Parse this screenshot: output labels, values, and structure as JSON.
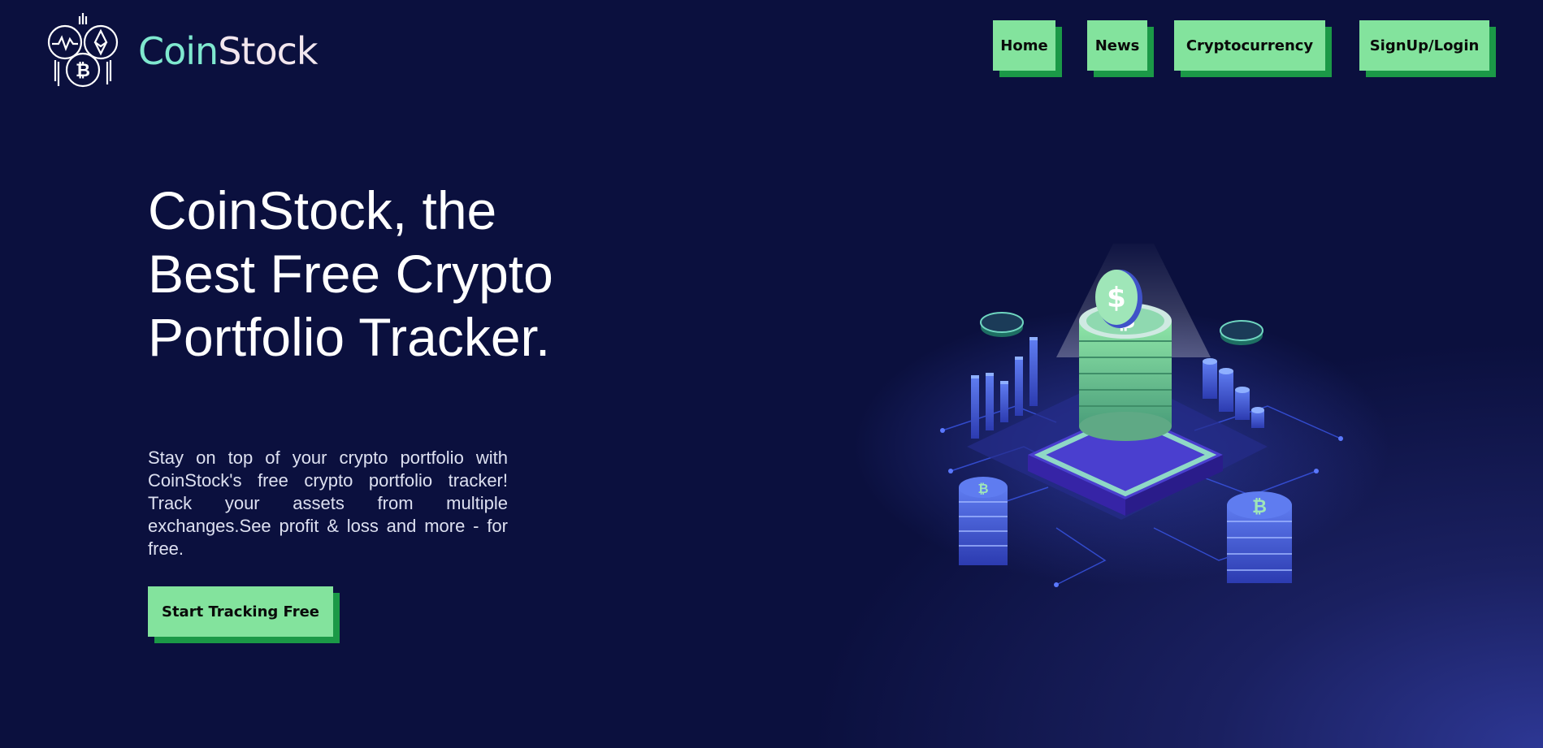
{
  "brand": {
    "name_part1": "Coin",
    "name_part2": "Stock"
  },
  "nav": [
    {
      "label": "Home"
    },
    {
      "label": "News"
    },
    {
      "label": "Cryptocurrency"
    },
    {
      "label": "SignUp/Login"
    }
  ],
  "hero": {
    "headline": "CoinStock, the Best Free Crypto Portfolio Tracker.",
    "subtext": "Stay on top of your crypto portfolio with CoinStock's free crypto portfolio tracker! Track your assets from multiple exchanges.See profit & loss and more - for free.",
    "cta_label": "Start Tracking Free"
  },
  "colors": {
    "background": "#0b103e",
    "button": "#83e39d",
    "button_shadow": "#1b9947",
    "brand_teal": "#7fe8cf"
  },
  "icons": [
    "coinstock-logo-icon",
    "bitcoin-icon",
    "ethereum-icon",
    "crypto-platform-illustration"
  ]
}
